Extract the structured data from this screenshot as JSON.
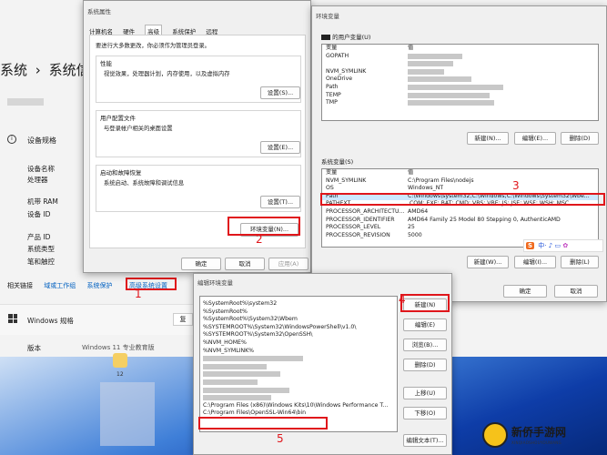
{
  "settings_page": {
    "breadcrumb_1": "系统",
    "breadcrumb_sep": "›",
    "breadcrumb_2": "系统信",
    "spec_header": "设备规格",
    "spec_labels": [
      "设备名称",
      "处理器",
      "机带 RAM",
      "设备 ID",
      "产品 ID",
      "系统类型",
      "笔和触控"
    ],
    "related_links_label": "相关链接",
    "links": [
      "域或工作组",
      "系统保护",
      "高级系统设置"
    ],
    "windows_spec": "Windows 规格",
    "copy_label": "复",
    "edition_label": "版本",
    "edition_value": "Windows 11 专业教育版",
    "taskbar_badge": "12"
  },
  "sysprops": {
    "title": "系统属性",
    "tabs": [
      "计算机名",
      "硬件",
      "高级",
      "系统保护",
      "远程"
    ],
    "admin_note": "要进行大多数更改，你必须作为管理员登录。",
    "perf_title": "性能",
    "perf_desc": "视觉效果，处理器计划，内存使用，以及虚拟内存",
    "settings_btn": "设置(S)...",
    "profile_title": "用户配置文件",
    "profile_desc": "与登录帐户相关的桌面设置",
    "profile_btn": "设置(E)...",
    "startup_title": "启动和故障恢复",
    "startup_desc": "系统启动、系统故障和调试信息",
    "startup_btn": "设置(T)...",
    "env_btn": "环境变量(N)...",
    "ok": "确定",
    "cancel": "取消",
    "apply": "应用(A)"
  },
  "envvars": {
    "title": "环境变量",
    "user_group_label": "的用户变量(U)",
    "col_var": "变量",
    "col_val": "值",
    "user_vars": [
      {
        "name": "GOPATH",
        "value": ""
      },
      {
        "name": "",
        "value": ""
      },
      {
        "name": "NVM_SYMLINK",
        "value": ""
      },
      {
        "name": "OneDrive",
        "value": ""
      },
      {
        "name": "Path",
        "value": ""
      },
      {
        "name": "TEMP",
        "value": ""
      },
      {
        "name": "TMP",
        "value": ""
      }
    ],
    "user_btns": [
      "新建(N)...",
      "编辑(E)...",
      "删除(D)"
    ],
    "sys_group_label": "系统变量(S)",
    "sys_vars": [
      {
        "name": "NVM_SYMLINK",
        "value": "C:\\Program Files\\nodejs"
      },
      {
        "name": "OS",
        "value": "Windows_NT"
      },
      {
        "name": "Path",
        "value": "C:\\Windows\\system32;C:\\Windows;C:\\Windows\\System32\\Wbe..."
      },
      {
        "name": "PATHEXT",
        "value": ".COM;.EXE;.BAT;.CMD;.VBS;.VBE;.JS;.JSE;.WSF;.WSH;.MSC"
      },
      {
        "name": "PROCESSOR_ARCHITECTU...",
        "value": "AMD64"
      },
      {
        "name": "PROCESSOR_IDENTIFIER",
        "value": "AMD64 Family 25 Model 80 Stepping 0, AuthenticAMD"
      },
      {
        "name": "PROCESSOR_LEVEL",
        "value": "25"
      },
      {
        "name": "PROCESSOR_REVISION",
        "value": "5000"
      }
    ],
    "sys_btns": [
      "新建(W)...",
      "编辑(I)...",
      "删除(L)"
    ],
    "ok": "确定",
    "cancel": "取消",
    "ime_s": "S",
    "ime_text": "中·"
  },
  "editenv": {
    "title": "编辑环境变量",
    "entries": [
      "%SystemRoot%\\system32",
      "%SystemRoot%",
      "%SystemRoot%\\System32\\Wbem",
      "%SYSTEMROOT%\\System32\\WindowsPowerShell\\v1.0\\",
      "%SYSTEMROOT%\\System32\\OpenSSH\\",
      "%NVM_HOME%",
      "%NVM_SYMLINK%",
      "",
      "",
      "",
      "",
      "",
      "",
      "C:\\Program Files (x86)\\Windows Kits\\10\\Windows Performance T...",
      "C:\\Program Files\\OpenSSL-Win64\\bin"
    ],
    "btns": [
      "新建(N)",
      "编辑(E)",
      "浏览(B)...",
      "删除(D)",
      "上移(U)",
      "下移(O)",
      "编辑文本(T)..."
    ]
  },
  "annotations": [
    "1",
    "2",
    "3",
    "4",
    "5"
  ],
  "watermark": {
    "text": "新侨手游网",
    "sub": "XINQIAOSHOUYOUWANG"
  },
  "colors": {
    "annotation": "#e0161b",
    "link": "#0060c0",
    "selection": "#cce8ff",
    "accent": "#0067c0"
  }
}
